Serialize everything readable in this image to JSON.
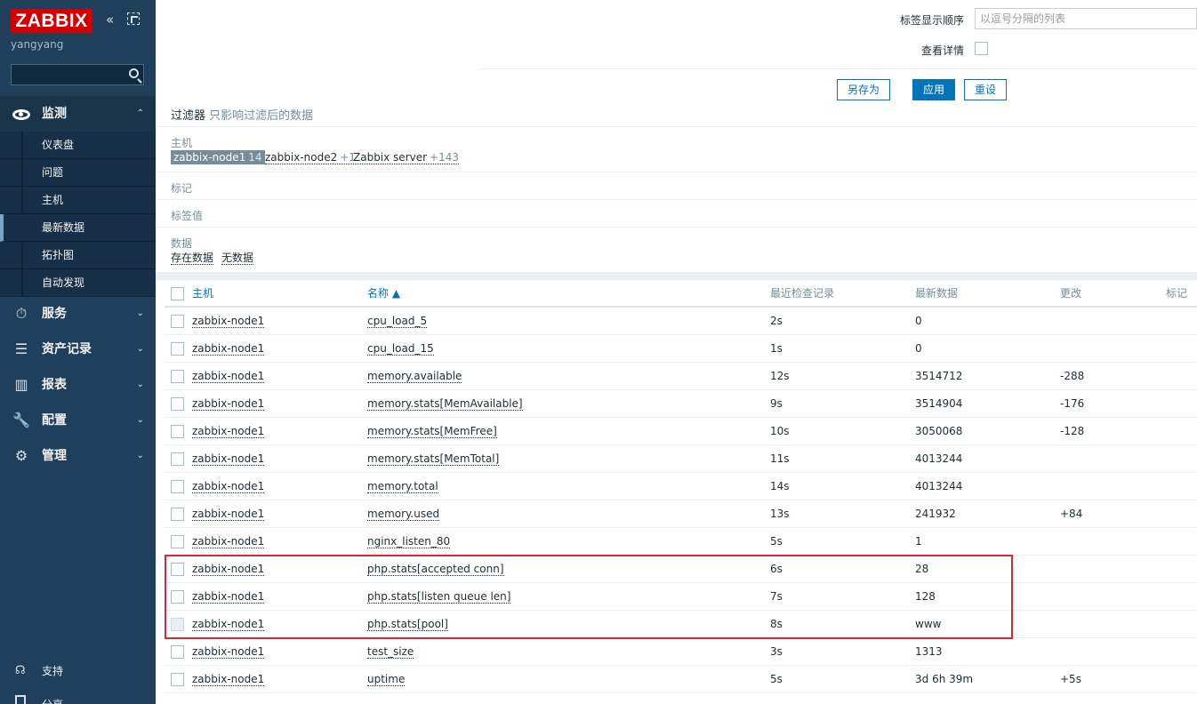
{
  "sidebar": {
    "logo": "ZABBIX",
    "username": "yangyang",
    "collapse_glyph": "«",
    "sections": [
      {
        "label": "监测",
        "icon": "eye-icon",
        "chevron": "⌃"
      },
      {
        "label": "服务",
        "icon": "clock-icon",
        "chevron": "⌄"
      },
      {
        "label": "资产记录",
        "icon": "list-icon",
        "chevron": "⌄"
      },
      {
        "label": "报表",
        "icon": "bar-chart-icon",
        "chevron": "⌄"
      },
      {
        "label": "配置",
        "icon": "wrench-icon",
        "chevron": "⌄"
      },
      {
        "label": "管理",
        "icon": "gear-icon",
        "chevron": "⌄"
      }
    ],
    "monitoring_items": [
      "仪表盘",
      "问题",
      "主机",
      "最新数据",
      "拓扑图",
      "自动发现"
    ],
    "support": "支持",
    "share": "分享"
  },
  "filter": {
    "tag_order_label": "标签显示顺序",
    "tag_order_placeholder": "以逗号分隔的列表",
    "show_details_label": "查看详情",
    "save_as": "另存为",
    "apply": "应用",
    "reset": "重设",
    "caption": "过滤器",
    "caption_sub": "只影响过滤后的数据",
    "host_group_title": "主机",
    "hosts": [
      {
        "name": "zabbix-node1",
        "count": "14"
      },
      {
        "name": "zabbix-node2",
        "count": "+1"
      },
      {
        "name": "Zabbix server",
        "count": "+143"
      }
    ],
    "tags_title": "标记",
    "tag_values_title": "标签值",
    "data_title": "数据",
    "data_options": [
      "存在数据",
      "无数据"
    ]
  },
  "table": {
    "headers": {
      "host": "主机",
      "name": "名称 ▲",
      "last_check": "最近检查记录",
      "last_value": "最新数据",
      "change": "更改",
      "tags": "标记"
    },
    "rows": [
      {
        "host": "zabbix-node1",
        "name": "cpu_load_5",
        "last_check": "2s",
        "last_value": "0",
        "change": ""
      },
      {
        "host": "zabbix-node1",
        "name": "cpu_load_15",
        "last_check": "1s",
        "last_value": "0",
        "change": ""
      },
      {
        "host": "zabbix-node1",
        "name": "memory.available",
        "last_check": "12s",
        "last_value": "3514712",
        "change": "-288"
      },
      {
        "host": "zabbix-node1",
        "name": "memory.stats[MemAvailable]",
        "last_check": "9s",
        "last_value": "3514904",
        "change": "-176"
      },
      {
        "host": "zabbix-node1",
        "name": "memory.stats[MemFree]",
        "last_check": "10s",
        "last_value": "3050068",
        "change": "-128"
      },
      {
        "host": "zabbix-node1",
        "name": "memory.stats[MemTotal]",
        "last_check": "11s",
        "last_value": "4013244",
        "change": ""
      },
      {
        "host": "zabbix-node1",
        "name": "memory.total",
        "last_check": "14s",
        "last_value": "4013244",
        "change": ""
      },
      {
        "host": "zabbix-node1",
        "name": "memory.used",
        "last_check": "13s",
        "last_value": "241932",
        "change": "+84"
      },
      {
        "host": "zabbix-node1",
        "name": "nginx_listen_80",
        "last_check": "5s",
        "last_value": "1",
        "change": ""
      },
      {
        "host": "zabbix-node1",
        "name": "php.stats[accepted conn]",
        "last_check": "6s",
        "last_value": "28",
        "change": ""
      },
      {
        "host": "zabbix-node1",
        "name": "php.stats[listen queue len]",
        "last_check": "7s",
        "last_value": "128",
        "change": ""
      },
      {
        "host": "zabbix-node1",
        "name": "php.stats[pool]",
        "last_check": "8s",
        "last_value": "www",
        "change": ""
      },
      {
        "host": "zabbix-node1",
        "name": "test_size",
        "last_check": "3s",
        "last_value": "1313",
        "change": ""
      },
      {
        "host": "zabbix-node1",
        "name": "uptime",
        "last_check": "5s",
        "last_value": "3d 6h 39m",
        "change": "+5s"
      }
    ]
  },
  "colors": {
    "sidebar_bg": "#1f3f5a",
    "accent": "#0275b8",
    "logo_red": "#d40000",
    "highlight": "#d9253a"
  }
}
